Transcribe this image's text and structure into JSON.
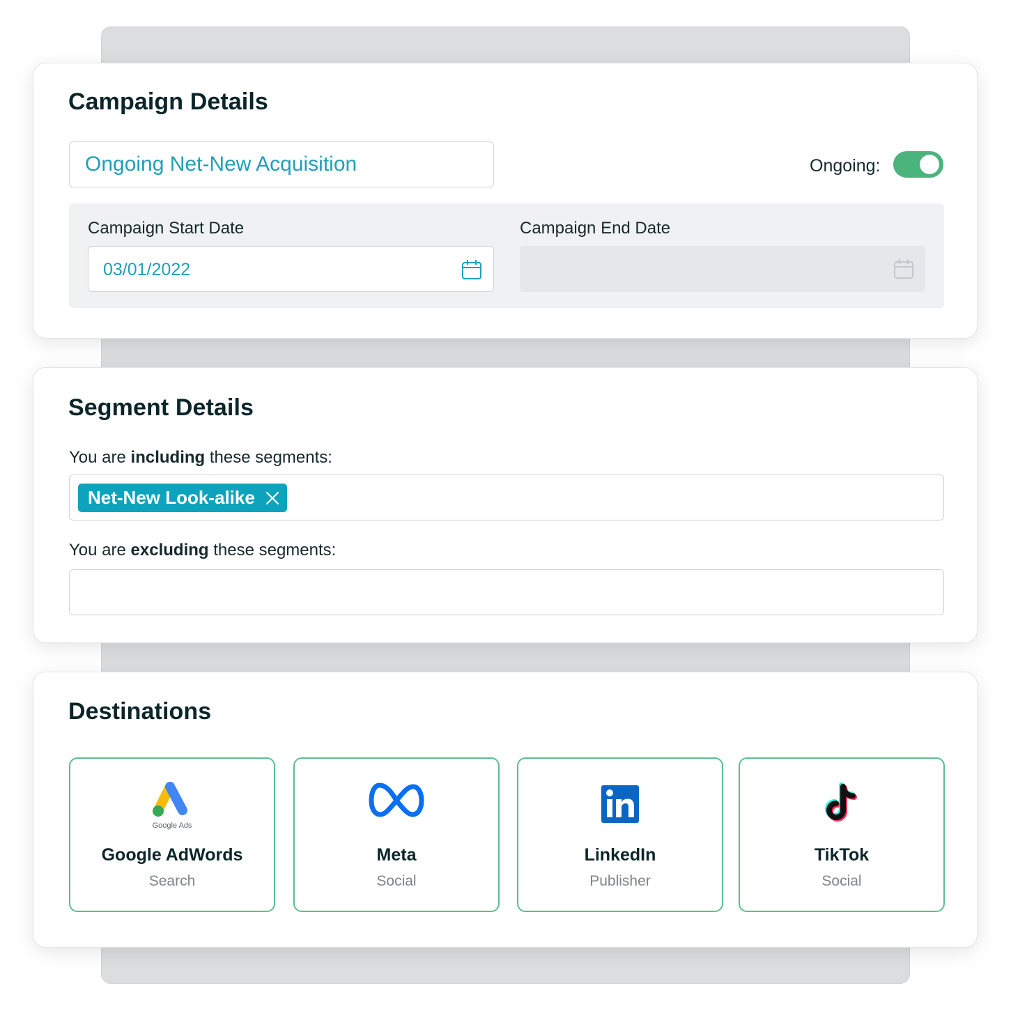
{
  "colors": {
    "accent_teal": "#0ea3bd",
    "toggle_green": "#4bb37c",
    "tile_border": "#5cbf8c",
    "title_text": "#0b2529"
  },
  "campaign": {
    "title": "Campaign Details",
    "name_value": "Ongoing Net-New Acquisition",
    "ongoing_label": "Ongoing:",
    "ongoing_on": true,
    "start_label": "Campaign Start Date",
    "start_value": "03/01/2022",
    "end_label": "Campaign End Date",
    "end_value": "",
    "icon": "calendar-icon"
  },
  "segment": {
    "title": "Segment Details",
    "include_prefix": "You are ",
    "include_bold": "including",
    "include_suffix": " these segments:",
    "included_chips": [
      "Net-New Look-alike"
    ],
    "exclude_prefix": "You are ",
    "exclude_bold": "excluding",
    "exclude_suffix": " these segments:"
  },
  "destinations": {
    "title": "Destinations",
    "items": [
      {
        "name": "Google AdWords",
        "type": "Search",
        "icon": "google-ads-icon",
        "logo_text": "Google Ads"
      },
      {
        "name": "Meta",
        "type": "Social",
        "icon": "meta-icon"
      },
      {
        "name": "LinkedIn",
        "type": "Publisher",
        "icon": "linkedin-icon"
      },
      {
        "name": "TikTok",
        "type": "Social",
        "icon": "tiktok-icon"
      }
    ]
  }
}
